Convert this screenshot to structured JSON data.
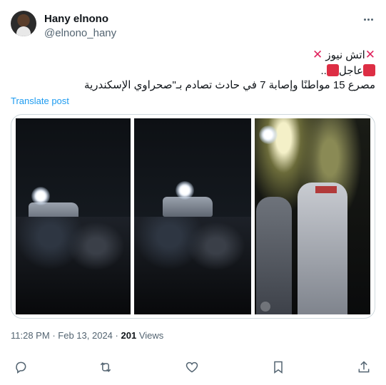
{
  "author": {
    "name": "Hany elnono",
    "handle": "@elnono_hany"
  },
  "tweet": {
    "line1": "اتش نيوز",
    "line2": "عاجل",
    "line2_suffix": "..",
    "line3": "مصرع 15 مواطنًا وإصابة 7 في حادث تصادم بـ\"صحراوي الإسكندرية",
    "translate_label": "Translate post"
  },
  "meta": {
    "time": "11:28 PM",
    "separator": "·",
    "date": "Feb 13, 2024",
    "views_count": "201",
    "views_label": "Views"
  },
  "icons": {
    "more": "more-horizontal-icon",
    "reply": "reply-icon",
    "retweet": "retweet-icon",
    "like": "heart-icon",
    "bookmark": "bookmark-icon",
    "share": "share-icon"
  },
  "colors": {
    "accent": "#1d9bf0",
    "secondary_text": "#536471",
    "cross": "#e0245e",
    "red_square": "#dd2e44"
  }
}
